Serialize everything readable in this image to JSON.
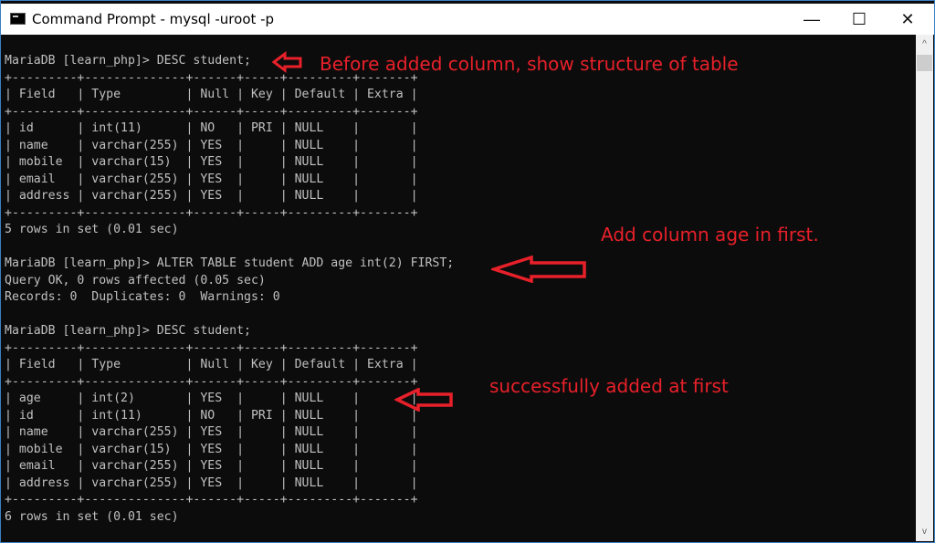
{
  "window": {
    "title": "Command Prompt - mysql  -uroot -p",
    "icon": "cmd-icon",
    "controls": {
      "minimize": "—",
      "maximize": "☐",
      "close": "✕"
    }
  },
  "console": {
    "lines": [
      "MariaDB [learn_php]> DESC student;",
      "+---------+--------------+------+-----+---------+-------+",
      "| Field   | Type         | Null | Key | Default | Extra |",
      "+---------+--------------+------+-----+---------+-------+",
      "| id      | int(11)      | NO   | PRI | NULL    |       |",
      "| name    | varchar(255) | YES  |     | NULL    |       |",
      "| mobile  | varchar(15)  | YES  |     | NULL    |       |",
      "| email   | varchar(255) | YES  |     | NULL    |       |",
      "| address | varchar(255) | YES  |     | NULL    |       |",
      "+---------+--------------+------+-----+---------+-------+",
      "5 rows in set (0.01 sec)",
      "",
      "MariaDB [learn_php]> ALTER TABLE student ADD age int(2) FIRST;",
      "Query OK, 0 rows affected (0.05 sec)",
      "Records: 0  Duplicates: 0  Warnings: 0",
      "",
      "MariaDB [learn_php]> DESC student;",
      "+---------+--------------+------+-----+---------+-------+",
      "| Field   | Type         | Null | Key | Default | Extra |",
      "+---------+--------------+------+-----+---------+-------+",
      "| age     | int(2)       | YES  |     | NULL    |       |",
      "| id      | int(11)      | NO   | PRI | NULL    |       |",
      "| name    | varchar(255) | YES  |     | NULL    |       |",
      "| mobile  | varchar(15)  | YES  |     | NULL    |       |",
      "| email   | varchar(255) | YES  |     | NULL    |       |",
      "| address | varchar(255) | YES  |     | NULL    |       |",
      "+---------+--------------+------+-----+---------+-------+",
      "6 rows in set (0.01 sec)"
    ]
  },
  "annotations": {
    "first": "Before added column, show structure of table",
    "second": "Add column age in first.",
    "third": "successfully added at first",
    "color": "#e8202a"
  },
  "scrollbar": {
    "up": "^",
    "down": "v"
  }
}
